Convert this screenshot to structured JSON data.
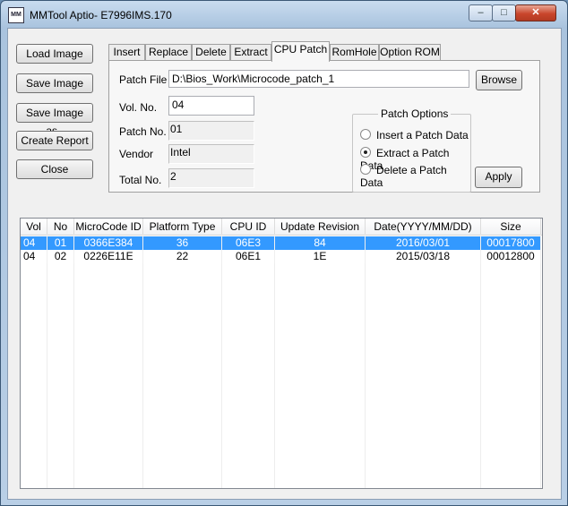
{
  "window": {
    "title": "MMTool Aptio- E7996IMS.170",
    "icon_text": "MM",
    "min_glyph": "–",
    "max_glyph": "□",
    "close_glyph": "✕"
  },
  "left_buttons": {
    "load": "Load Image",
    "save": "Save Image",
    "save_as": "Save Image as..",
    "report": "Create Report",
    "close": "Close"
  },
  "tabs": [
    "Insert",
    "Replace",
    "Delete",
    "Extract",
    "CPU Patch",
    "RomHole",
    "Option ROM"
  ],
  "active_tab": "CPU Patch",
  "patch": {
    "file_label": "Patch File",
    "file_value": "D:\\Bios_Work\\Microcode_patch_1",
    "browse": "Browse",
    "vol_label": "Vol. No.",
    "vol_value": "04",
    "patchno_label": "Patch No.",
    "patchno_value": "01",
    "vendor_label": "Vendor",
    "vendor_value": "Intel",
    "total_label": "Total No.",
    "total_value": "2",
    "options_legend": "Patch Options",
    "opt_insert": "Insert a Patch Data",
    "opt_extract": "Extract a Patch Data",
    "opt_delete": "Delete a Patch Data",
    "selected_option": "extract",
    "apply": "Apply"
  },
  "table": {
    "columns": [
      "Vol",
      "No",
      "MicroCode ID",
      "Platform Type",
      "CPU ID",
      "Update Revision",
      "Date(YYYY/MM/DD)",
      "Size"
    ],
    "rows": [
      [
        "04",
        "01",
        "0366E384",
        "36",
        "06E3",
        "84",
        "2016/03/01",
        "00017800"
      ],
      [
        "04",
        "02",
        "0226E11E",
        "22",
        "06E1",
        "1E",
        "2015/03/18",
        "00012800"
      ]
    ],
    "selected_row": 0
  },
  "colors": {
    "selection": "#3399ff"
  }
}
